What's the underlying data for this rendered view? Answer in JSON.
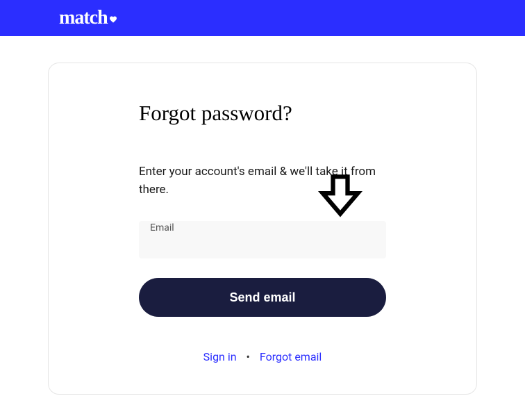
{
  "header": {
    "logo_text": "match"
  },
  "card": {
    "title": "Forgot password?",
    "description": "Enter your account's email & we'll take it from there.",
    "email_label": "Email",
    "email_value": "",
    "submit_label": "Send email"
  },
  "footer": {
    "sign_in": "Sign in",
    "forgot_email": "Forgot email"
  }
}
